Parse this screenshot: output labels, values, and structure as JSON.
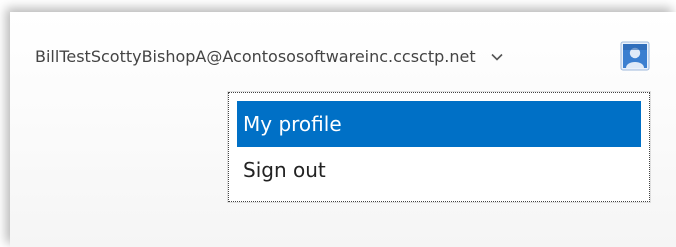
{
  "account": {
    "email": "BillTestScottyBishopA@Acontososoftwareinc.ccsctp.net",
    "chevron_icon": "chevron-down-icon",
    "avatar_icon": "user-avatar-icon"
  },
  "menu": {
    "items": [
      {
        "label": "My profile",
        "selected": true
      },
      {
        "label": "Sign out",
        "selected": false
      }
    ]
  },
  "colors": {
    "highlight": "#0070c6",
    "avatar_blue": "#2a6fbf"
  }
}
